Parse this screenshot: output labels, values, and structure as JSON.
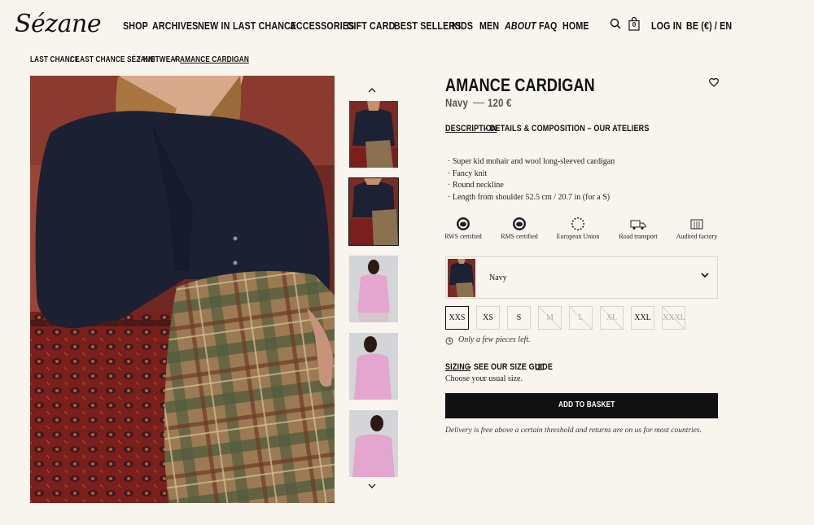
{
  "header": {
    "logo": "Sézane",
    "nav": [
      "SHOP",
      "ARCHIVES",
      "NEW IN",
      "LAST CHANCE",
      "ACCESSORIES",
      "GIFT CARD",
      "BEST SELLERS",
      "KIDS",
      "MEN",
      "ABOUT",
      "FAQ",
      "HOME"
    ],
    "cart_count": "0",
    "login": "LOG IN",
    "locale": "BE (€) / EN"
  },
  "breadcrumb": [
    "LAST CHANCE",
    "/",
    "LAST CHANCE SÉZANE",
    "/",
    "KNITWEAR",
    "/",
    "AMANCE CARDIGAN"
  ],
  "product": {
    "title": "AMANCE CARDIGAN",
    "color": "Navy",
    "separator": "—",
    "price": "120 €",
    "tabs": [
      "DESCRIPTION",
      " – DETAILS & COMPOSITION – OUR ATELIERS"
    ],
    "features": [
      "· Super kid mohair and wool long-sleeved cardigan",
      "· Fancy knit",
      "· Round neckline",
      "· Length from shoulder 52.5 cm / 20.7 in (for a S)"
    ],
    "certifications": [
      "RWS certified",
      "RMS certified",
      "European Union",
      "Road transport",
      "Audited factory"
    ],
    "selected_color": "Navy",
    "sizes": [
      "XXS",
      "XS",
      "S",
      "M",
      "L",
      "XL",
      "XXL",
      "XXXL"
    ],
    "selected_size": "XXS",
    "stock_note": "Only a few pieces left.",
    "sizing_label": "SIZING",
    "sizing_guide": " – SEE OUR SIZE GUIDE",
    "choose_size": "Choose your usual size.",
    "add_to_basket": "ADD TO BASKET",
    "delivery": "Delivery is free above a certain threshold and returns are on us for most countries."
  },
  "thumbnails": [
    {
      "selected": false,
      "sweater": "#1c2233"
    },
    {
      "selected": true,
      "sweater": "#1c2233"
    },
    {
      "selected": false,
      "sweater": "#e4a6cf"
    },
    {
      "selected": false,
      "sweater": "#e4a6cf"
    },
    {
      "selected": false,
      "sweater": "#e4a6cf"
    }
  ],
  "colors": {
    "accent": "#111111",
    "background": "#f8f5ef",
    "border": "#dcd7ce"
  }
}
